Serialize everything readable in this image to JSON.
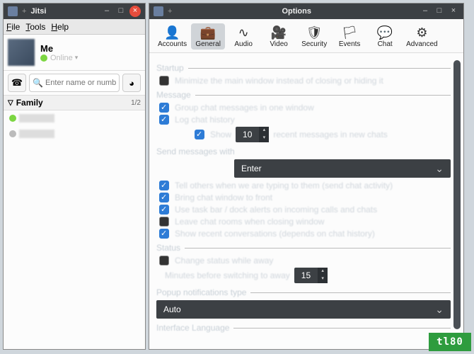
{
  "main": {
    "title": "Jitsi",
    "menu": {
      "file": "File",
      "tools": "Tools",
      "help": "Help"
    },
    "me_label": "Me",
    "status_text": "Online",
    "search_placeholder": "Enter name or number",
    "group_name": "Family",
    "group_count": "1/2"
  },
  "options": {
    "title": "Options",
    "tabs": {
      "accounts": "Accounts",
      "general": "General",
      "audio": "Audio",
      "video": "Video",
      "security": "Security",
      "events": "Events",
      "chat": "Chat",
      "advanced": "Advanced"
    },
    "sections": {
      "startup": "Startup",
      "message": "Message",
      "send_with": "Send messages with",
      "status": "Status",
      "popup": "Popup notifications type",
      "lang": "Interface Language"
    },
    "opts": {
      "minimize": "Minimize the main window instead of closing or hiding it",
      "group_chat": "Group chat messages in one window",
      "log_history": "Log chat history",
      "show": "Show",
      "show_tail": "recent messages in new chats",
      "tell_others": "Tell others when we are typing to them (send chat activity)",
      "bring_front": "Bring chat window to front",
      "taskbar": "Use task bar / dock alerts on incoming calls and chats",
      "leave_rooms": "Leave chat rooms when closing window",
      "recent_conv": "Show recent conversations (depends on chat history)",
      "change_status": "Change status while away",
      "minutes_away": "Minutes before switching to away"
    },
    "values": {
      "recent_count": "10",
      "send_key": "Enter",
      "away_minutes": "15",
      "popup_type": "Auto"
    }
  },
  "watermark": "tl80"
}
